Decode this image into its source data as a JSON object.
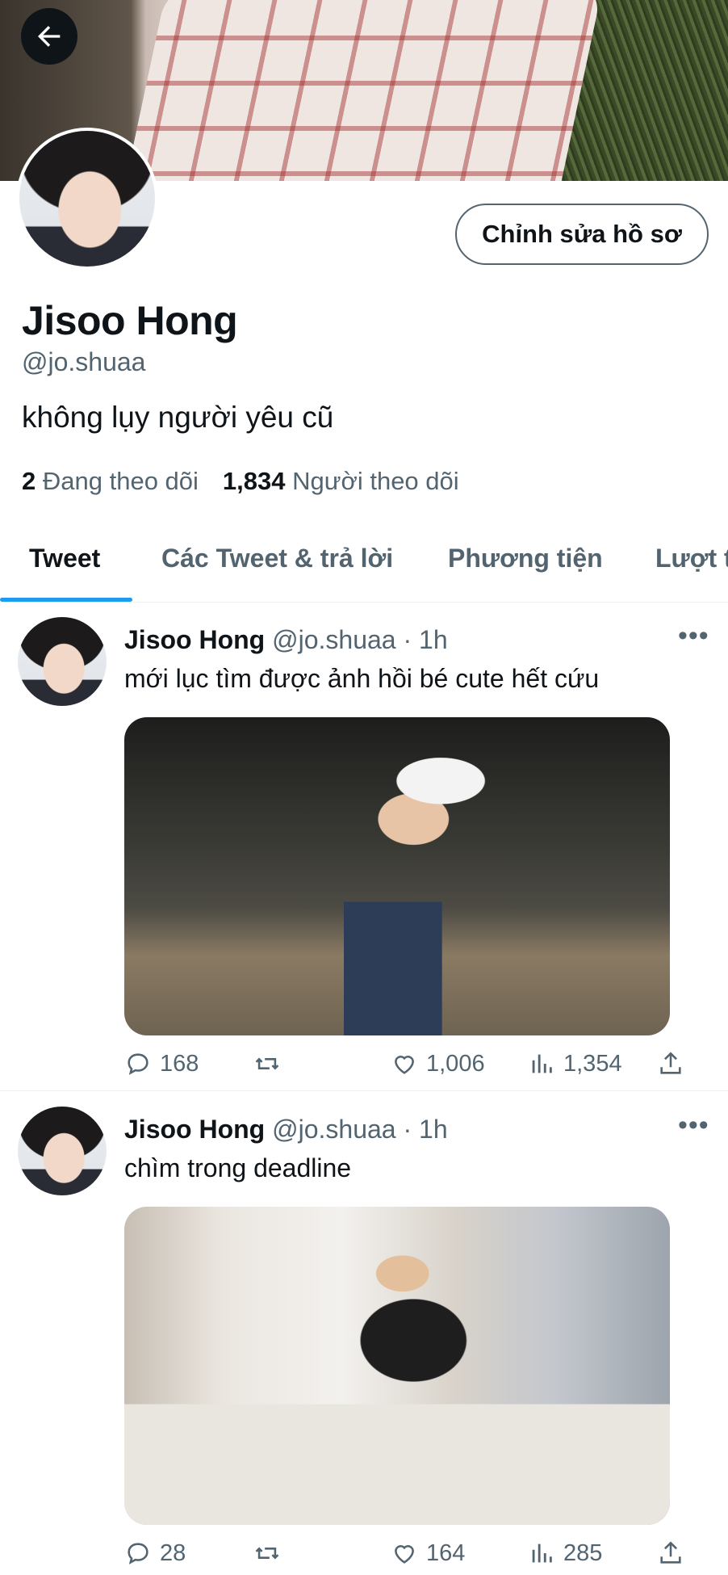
{
  "profile": {
    "edit_label": "Chỉnh sửa hồ sơ",
    "name": "Jisoo Hong",
    "handle": "@jo.shuaa",
    "bio": "không lụy người yêu cũ",
    "following_count": "2",
    "following_label": "Đang theo dõi",
    "followers_count": "1,834",
    "followers_label": "Người theo dõi"
  },
  "tabs": [
    {
      "label": "Tweet"
    },
    {
      "label": "Các Tweet & trả lời"
    },
    {
      "label": "Phương tiện"
    },
    {
      "label": "Lượt t"
    }
  ],
  "tweets": [
    {
      "name": "Jisoo Hong",
      "meta": "@jo.shuaa · 1h",
      "text": "mới lục tìm được ảnh hồi bé cute hết cứu",
      "replies": "168",
      "likes": "1,006",
      "views": "1,354"
    },
    {
      "name": "Jisoo Hong",
      "meta": "@jo.shuaa · 1h",
      "text": "chìm trong deadline",
      "replies": "28",
      "likes": "164",
      "views": "285"
    }
  ],
  "colors": {
    "accent": "#1d9bf0",
    "text": "#0f1419",
    "muted": "#536471"
  },
  "icons": [
    "arrow-left-icon",
    "more-icon",
    "reply-icon",
    "retweet-icon",
    "like-icon",
    "views-icon",
    "share-icon"
  ]
}
